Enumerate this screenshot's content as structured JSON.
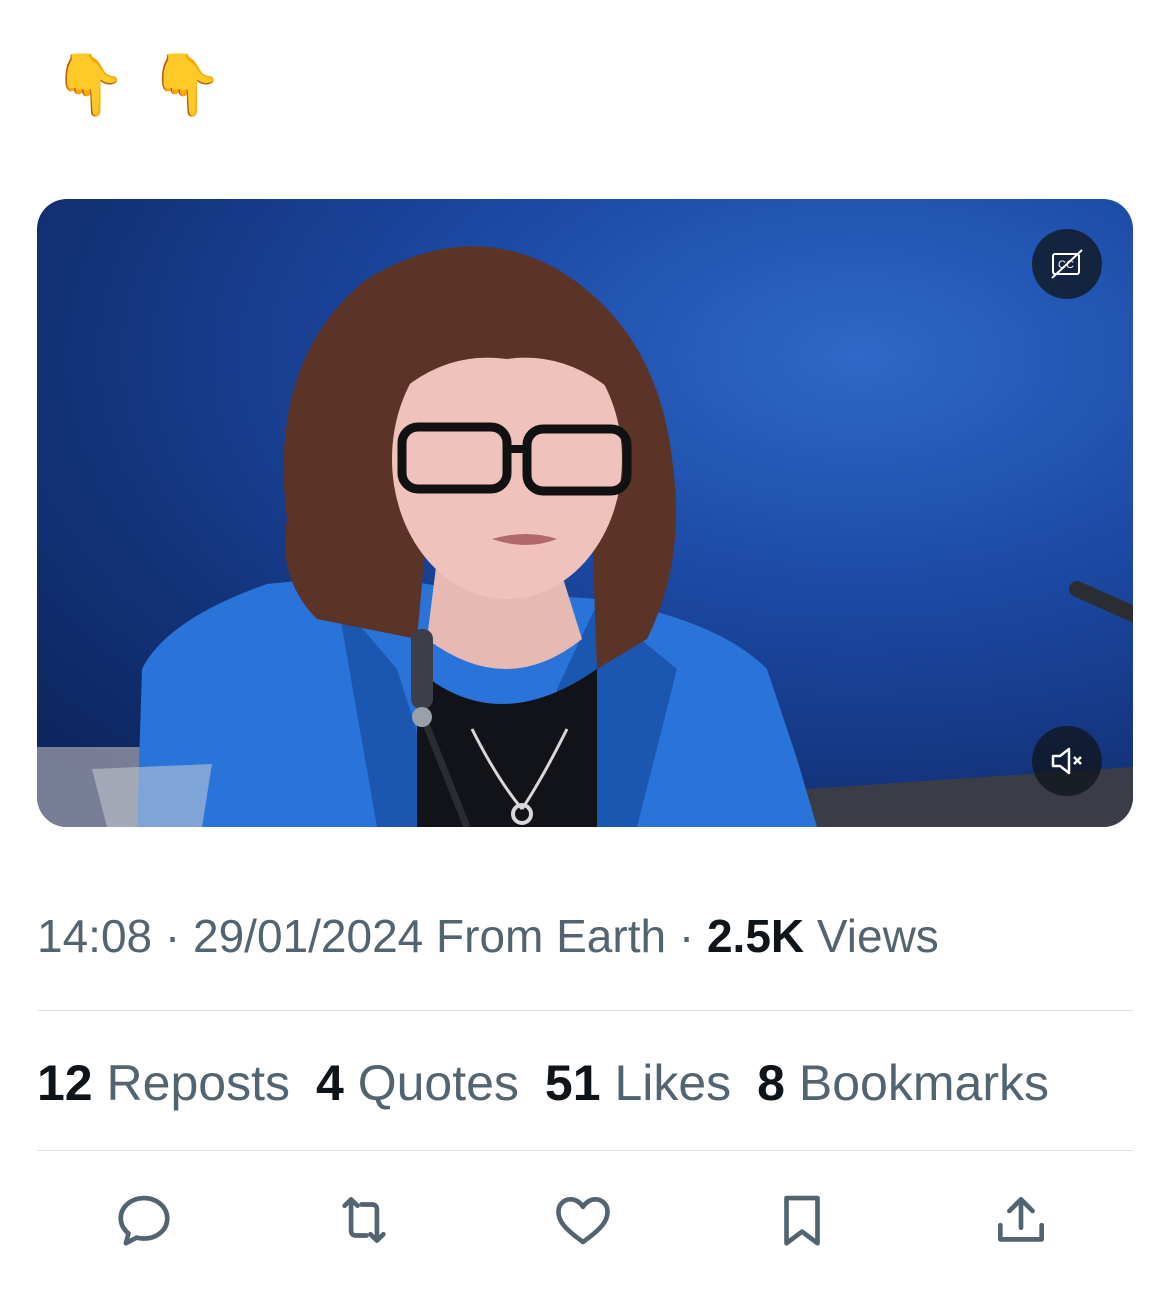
{
  "post": {
    "text_emojis": [
      "👇",
      "👇"
    ]
  },
  "video": {
    "cc_icon": "captions-off-icon",
    "mute_icon": "speaker-muted-icon",
    "cc_label": "CC"
  },
  "meta": {
    "time": "14:08",
    "sep1": " · ",
    "date": "29/01/2024",
    "source": " From Earth",
    "sep2": " · ",
    "views_count": "2.5K",
    "views_label": " Views"
  },
  "stats": [
    {
      "count": "12",
      "label": "Reposts"
    },
    {
      "count": "4",
      "label": "Quotes"
    },
    {
      "count": "51",
      "label": "Likes"
    },
    {
      "count": "8",
      "label": "Bookmarks"
    }
  ],
  "actions": [
    "reply-icon",
    "repost-icon",
    "like-icon",
    "bookmark-icon",
    "share-icon"
  ],
  "colors": {
    "text_primary": "#0f1419",
    "text_secondary": "#536471",
    "divider": "#dfe3e6",
    "emoji": "#f5b400"
  }
}
